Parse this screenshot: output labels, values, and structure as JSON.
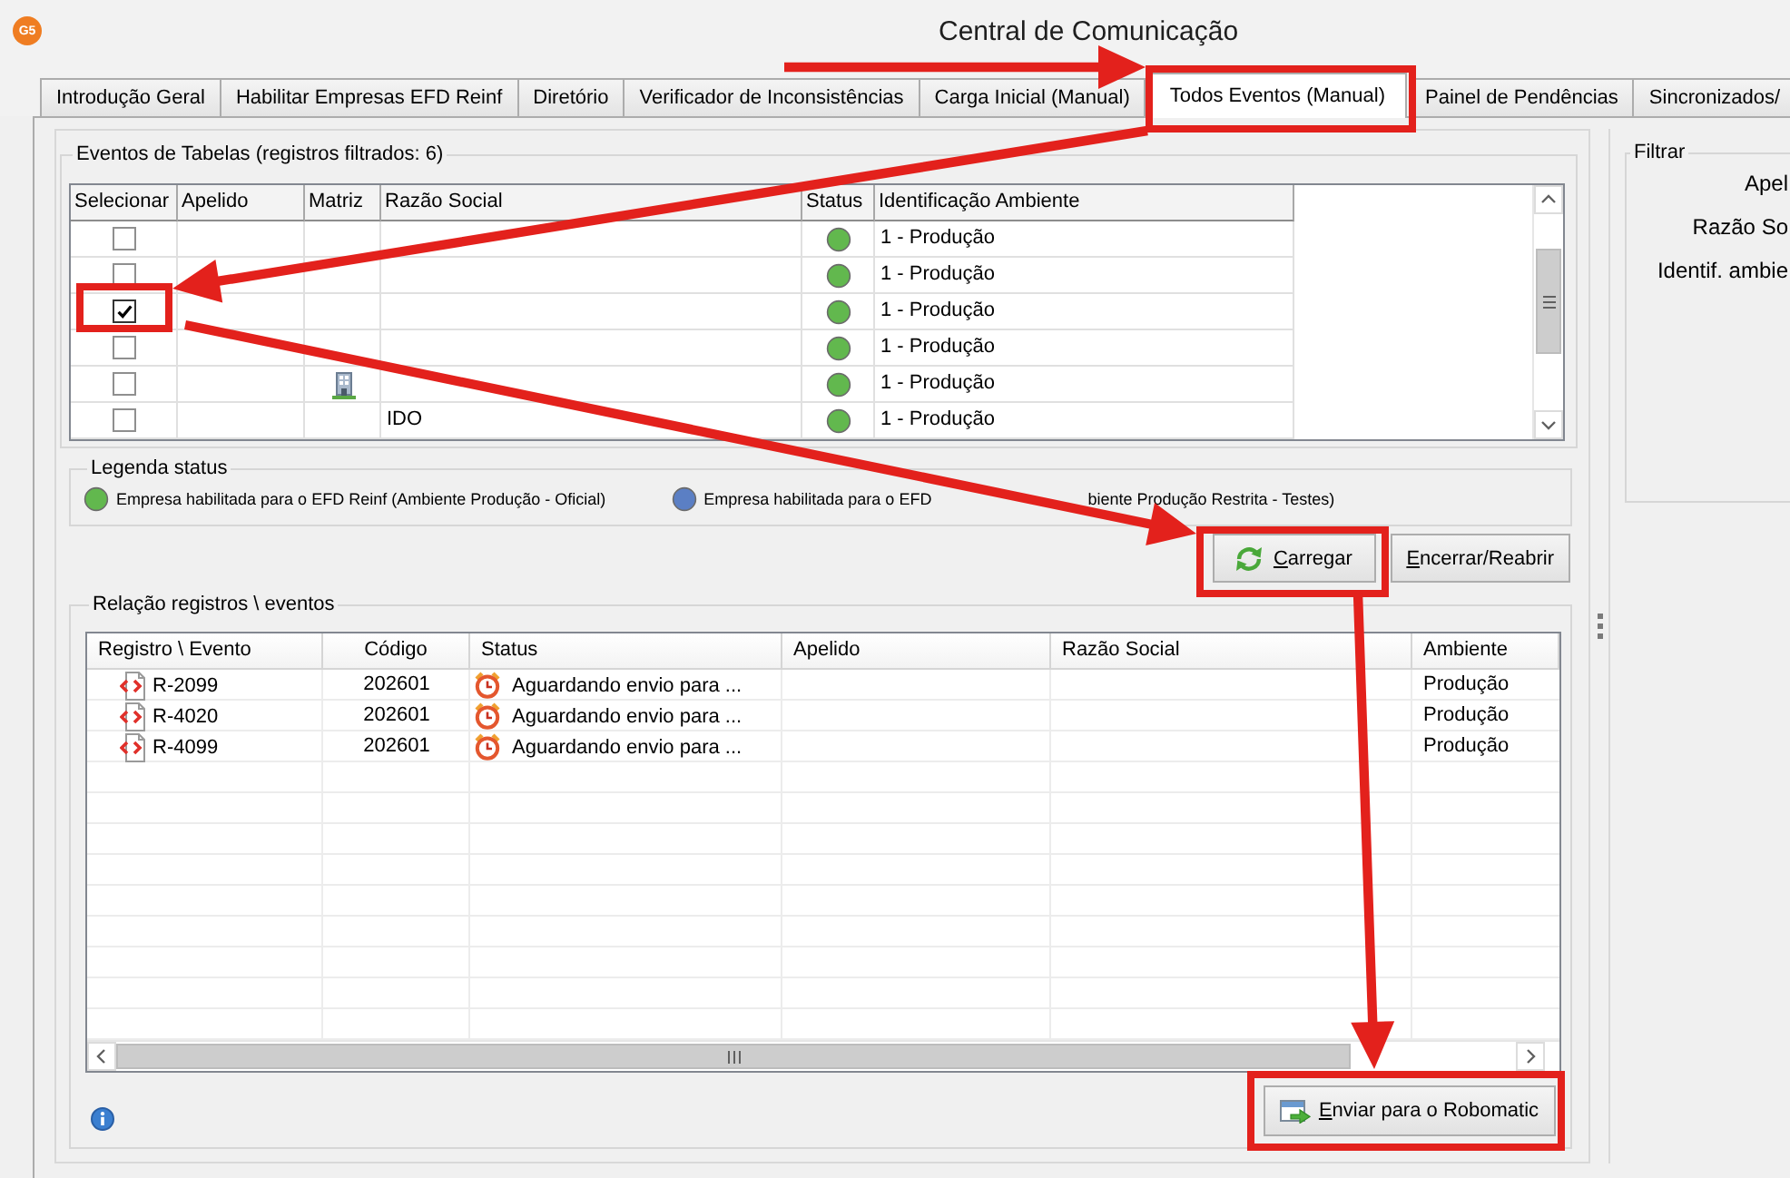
{
  "window": {
    "logo": "G5",
    "title": "Central de Comunicação"
  },
  "tabs": [
    {
      "label": "Introdução Geral",
      "selected": false
    },
    {
      "label": "Habilitar Empresas EFD Reinf",
      "selected": false
    },
    {
      "label": "Diretório",
      "selected": false
    },
    {
      "label": "Verificador de Inconsistências",
      "selected": false
    },
    {
      "label": "Carga Inicial (Manual)",
      "selected": false
    },
    {
      "label": "Todos Eventos (Manual)",
      "selected": true
    },
    {
      "label": "Painel de Pendências",
      "selected": false
    },
    {
      "label": "Sincronizados/",
      "selected": false
    }
  ],
  "events_table": {
    "title": "Eventos de Tabelas (registros filtrados: 6)",
    "columns": [
      "Selecionar",
      "Apelido",
      "Matriz",
      "Razão Social",
      "Status",
      "Identificação Ambiente"
    ],
    "rows": [
      {
        "checked": false,
        "matriz": false,
        "color": "#62b84e",
        "ambiente": "1 - Produção"
      },
      {
        "checked": false,
        "matriz": false,
        "color": "#62b84e",
        "ambiente": "1 - Produção"
      },
      {
        "checked": true,
        "matriz": false,
        "color": "#62b84e",
        "ambiente": "1 - Produção"
      },
      {
        "checked": false,
        "matriz": false,
        "color": "#62b84e",
        "ambiente": "1 - Produção"
      },
      {
        "checked": false,
        "matriz": true,
        "color": "#62b84e",
        "ambiente": "1 - Produção"
      },
      {
        "checked": false,
        "matriz": false,
        "razao_social": "IDO",
        "color": "#62b84e",
        "ambiente": "1 - Produção"
      }
    ]
  },
  "legend": {
    "title": "Legenda status",
    "items": [
      {
        "color": "#62b84e",
        "label": "Empresa habilitada para o EFD Reinf (Ambiente Produção - Oficial)"
      },
      {
        "color": "#5b7fc4",
        "label": "Empresa habilitada para o EFD",
        "label_after": "biente Produção Restrita - Testes)"
      }
    ]
  },
  "actions": [
    {
      "label": "Carregar",
      "kind": "iconbutton"
    },
    {
      "label": "Encerrar/Reabrir",
      "kind": "textbutton"
    }
  ],
  "records": {
    "title": "Relação registros \\ eventos",
    "columns": [
      "Registro \\ Evento",
      "Código",
      "Status",
      "Apelido",
      "Razão Social",
      "Ambiente"
    ],
    "rows": [
      {
        "registro": "R-2099",
        "codigo": "202601",
        "status": "Aguardando envio para ...",
        "ambiente": "Produção"
      },
      {
        "registro": "R-4020",
        "codigo": "202601",
        "status": "Aguardando envio para ...",
        "ambiente": "Produção"
      },
      {
        "registro": "R-4099",
        "codigo": "202601",
        "status": "Aguardando envio para ...",
        "ambiente": "Produção"
      }
    ]
  },
  "send_button": {
    "label": "Enviar para o Robomatic"
  },
  "filter": {
    "title": "Filtrar",
    "labels": [
      "Apel",
      "Razão So",
      "Identif. ambie"
    ]
  },
  "annotations": [
    {
      "kind": "arrow"
    },
    {
      "kind": "frame"
    },
    {
      "kind": "arrow"
    },
    {
      "kind": "frame"
    },
    {
      "kind": "arrow"
    },
    {
      "kind": "frame"
    },
    {
      "kind": "arrow"
    },
    {
      "kind": "frame"
    }
  ]
}
